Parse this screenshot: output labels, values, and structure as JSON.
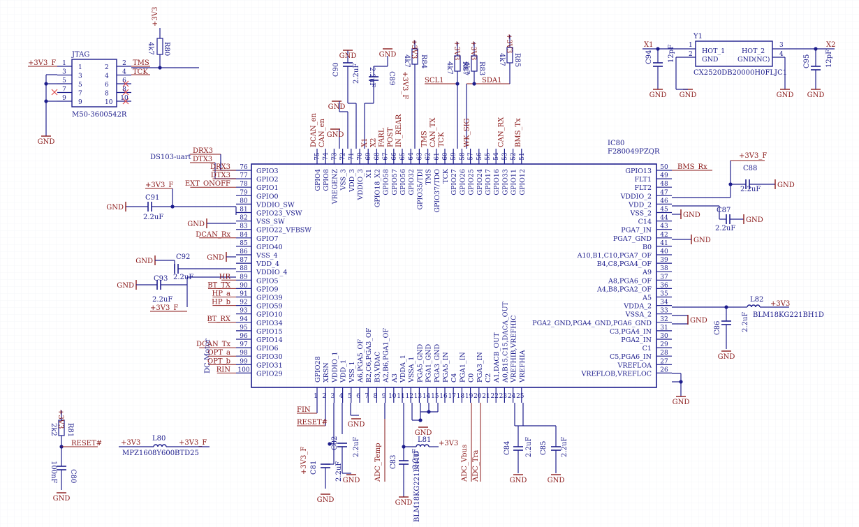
{
  "colors": {
    "wire": "#1d1d8c",
    "body": "#1d1d8c",
    "text": "#1d1d8c",
    "net": "#8b1a1a",
    "power": "#8b1a1a",
    "cross": "#e05050",
    "grid": "#eef0f4"
  },
  "mcu": {
    "designator": "IC80",
    "part": "F280049PZQR",
    "left_pins": [
      {
        "num": "76",
        "name": "GPIO3",
        "net": "DRX3"
      },
      {
        "num": "77",
        "name": "GPIO2",
        "net": "DTX3"
      },
      {
        "num": "78",
        "name": "GPIO1",
        "net": "EXT_ONOFF"
      },
      {
        "num": "79",
        "name": "GPIO0",
        "net": ""
      },
      {
        "num": "80",
        "name": "VDDIO_SW",
        "net": ""
      },
      {
        "num": "81",
        "name": "GPIO23_VSW",
        "net": ""
      },
      {
        "num": "82",
        "name": "VSS_SW",
        "net": ""
      },
      {
        "num": "83",
        "name": "GPIO22_VFBSW",
        "net": ""
      },
      {
        "num": "84",
        "name": "GPIO7",
        "net": "DCAN_Rx"
      },
      {
        "num": "85",
        "name": "GPIO40",
        "net": ""
      },
      {
        "num": "86",
        "name": "VSS_4",
        "net": ""
      },
      {
        "num": "87",
        "name": "VDD_4",
        "net": ""
      },
      {
        "num": "88",
        "name": "VDDIO_4",
        "net": ""
      },
      {
        "num": "89",
        "name": "GPIO5",
        "net": "HR"
      },
      {
        "num": "90",
        "name": "GPIO9",
        "net": "BT_TX"
      },
      {
        "num": "91",
        "name": "GPIO39",
        "net": "HP_a"
      },
      {
        "num": "92",
        "name": "GPIO59",
        "net": "HP_b"
      },
      {
        "num": "93",
        "name": "GPIO10",
        "net": ""
      },
      {
        "num": "94",
        "name": "GPIO34",
        "net": "BT_RX"
      },
      {
        "num": "95",
        "name": "GPIO15",
        "net": ""
      },
      {
        "num": "96",
        "name": "GPIO14",
        "net": ""
      },
      {
        "num": "97",
        "name": "GPIO6",
        "net": "DCAN_Tx"
      },
      {
        "num": "98",
        "name": "GPIO30",
        "net": "OPT_a"
      },
      {
        "num": "99",
        "name": "GPIO31",
        "net": "OPT_b"
      },
      {
        "num": "100",
        "name": "GPIO29",
        "net": "RIN"
      }
    ],
    "right_pins": [
      {
        "num": "50",
        "name": "GPIO13",
        "net": "BMS_Rx"
      },
      {
        "num": "49",
        "name": "FLT1",
        "net": ""
      },
      {
        "num": "48",
        "name": "FLT2",
        "net": ""
      },
      {
        "num": "47",
        "name": "VDDIO_2",
        "net": ""
      },
      {
        "num": "46",
        "name": "VDD_2",
        "net": ""
      },
      {
        "num": "45",
        "name": "VSS_2",
        "net": ""
      },
      {
        "num": "44",
        "name": "C14",
        "net": ""
      },
      {
        "num": "43",
        "name": "PGA7_IN",
        "net": ""
      },
      {
        "num": "42",
        "name": "PGA7_GND",
        "net": ""
      },
      {
        "num": "41",
        "name": "B0",
        "net": ""
      },
      {
        "num": "40",
        "name": "A10,B1,C10,PGA7_OF",
        "net": ""
      },
      {
        "num": "39",
        "name": "B4,C8,PGA4_OF",
        "net": ""
      },
      {
        "num": "38",
        "name": "A9",
        "net": ""
      },
      {
        "num": "37",
        "name": "A8,PGA6_OF",
        "net": ""
      },
      {
        "num": "36",
        "name": "A4,B8,PGA2_OF",
        "net": ""
      },
      {
        "num": "35",
        "name": "A5",
        "net": ""
      },
      {
        "num": "34",
        "name": "VDDA_2",
        "net": ""
      },
      {
        "num": "33",
        "name": "VSSA_2",
        "net": ""
      },
      {
        "num": "32",
        "name": "PGA2_GND,PGA4_GND,PGA6_GND",
        "net": ""
      },
      {
        "num": "31",
        "name": "C3,PGA4_IN",
        "net": ""
      },
      {
        "num": "30",
        "name": "PGA2_IN",
        "net": ""
      },
      {
        "num": "29",
        "name": "C1",
        "net": ""
      },
      {
        "num": "28",
        "name": "C5,PGA6_IN",
        "net": ""
      },
      {
        "num": "27",
        "name": "VREFLOA",
        "net": ""
      },
      {
        "num": "26",
        "name": "VREFLOB,VREFLOC",
        "net": ""
      }
    ],
    "top_pins": [
      {
        "num": "75",
        "name": "GPIO4",
        "net": "DCAN_en"
      },
      {
        "num": "74",
        "name": "GPIO8",
        "net": "CAN_en"
      },
      {
        "num": "73",
        "name": "VREGENZ",
        "net": ""
      },
      {
        "num": "72",
        "name": "VSS_3",
        "net": ""
      },
      {
        "num": "71",
        "name": "VDD_3",
        "net": ""
      },
      {
        "num": "70",
        "name": "VDDIO_3",
        "net": ""
      },
      {
        "num": "69",
        "name": "X1",
        "net": "X1"
      },
      {
        "num": "68",
        "name": "GPIO18_X2",
        "net": "X2"
      },
      {
        "num": "67",
        "name": "GPIO58",
        "net": "FARL"
      },
      {
        "num": "66",
        "name": "GPIO57",
        "net": "POST"
      },
      {
        "num": "65",
        "name": "GPIO56",
        "net": "IN_REAR"
      },
      {
        "num": "64",
        "name": "GPIO32",
        "net": ""
      },
      {
        "num": "63",
        "name": "GPIO35/TDI",
        "net": ""
      },
      {
        "num": "62",
        "name": "TMS",
        "net": "TMS"
      },
      {
        "num": "61",
        "name": "GPIO37/TDO",
        "net": "CAN_TX"
      },
      {
        "num": "60",
        "name": "TCK",
        "net": "TCK"
      },
      {
        "num": "59",
        "name": "GPIO27",
        "net": ""
      },
      {
        "num": "58",
        "name": "GPIO26",
        "net": ""
      },
      {
        "num": "57",
        "name": "GPIO25",
        "net": "WK_SIG"
      },
      {
        "num": "56",
        "name": "GPIO24",
        "net": ""
      },
      {
        "num": "55",
        "name": "GPIO17",
        "net": ""
      },
      {
        "num": "54",
        "name": "GPIO16",
        "net": ""
      },
      {
        "num": "53",
        "name": "GPIO33",
        "net": "CAN_RX"
      },
      {
        "num": "52",
        "name": "GPIO11",
        "net": ""
      },
      {
        "num": "51",
        "name": "GPIO12",
        "net": "BMS_Tx"
      }
    ],
    "bottom_pins": [
      {
        "num": "1",
        "name": "GPIO28"
      },
      {
        "num": "2",
        "name": "XRSN"
      },
      {
        "num": "3",
        "name": "VDDIO_1"
      },
      {
        "num": "4",
        "name": "VDD_1"
      },
      {
        "num": "5",
        "name": "VSS_1"
      },
      {
        "num": "6",
        "name": "A6,PGA5_OF"
      },
      {
        "num": "7",
        "name": "B2,C6,PGA3_OF"
      },
      {
        "num": "8",
        "name": "B3,VDAC"
      },
      {
        "num": "9",
        "name": "A2,B6,PGA1_OF"
      },
      {
        "num": "10",
        "name": "A3"
      },
      {
        "num": "11",
        "name": "VDDA_1"
      },
      {
        "num": "12",
        "name": "VSSA_1"
      },
      {
        "num": "13",
        "name": "PGA5_GND"
      },
      {
        "num": "14",
        "name": "PGA1_GND"
      },
      {
        "num": "15",
        "name": "PGA3_GND"
      },
      {
        "num": "16",
        "name": "PGA5_IN"
      },
      {
        "num": "17",
        "name": "C4"
      },
      {
        "num": "18",
        "name": "PGA1_IN"
      },
      {
        "num": "19",
        "name": "C0"
      },
      {
        "num": "20",
        "name": "PGA3_IN"
      },
      {
        "num": "21",
        "name": "C2"
      },
      {
        "num": "22",
        "name": "A1,DACB_OUT"
      },
      {
        "num": "23",
        "name": "A0,B15,C15,DACA_OUT"
      },
      {
        "num": "24",
        "name": "VREFHIB,VREFHIC"
      },
      {
        "num": "25",
        "name": "VREFHIA"
      }
    ]
  },
  "jtag": {
    "title": "JTAG",
    "part": "M50-3600542R",
    "left_pins": [
      "1",
      "3",
      "5",
      "7",
      "9"
    ],
    "right_pins": [
      "2",
      "4",
      "6",
      "8",
      "10"
    ],
    "left_outer": [
      "1",
      "3",
      "5",
      "7",
      "9"
    ],
    "right_outer": [
      "2",
      "4",
      "6",
      "8",
      "10"
    ],
    "net_power": "+3V3_F",
    "net_tms": "TMS",
    "net_tck": "TCK"
  },
  "crystal": {
    "designator": "Y1",
    "part": "CX2520DB20000H0FLJC1",
    "pin_labels": [
      "HOT_1",
      "GND",
      "HOT_2",
      "GND(NC)"
    ],
    "pin_nums": [
      "1",
      "2",
      "3",
      "4"
    ],
    "net_x1": "X1",
    "net_x2": "X2"
  },
  "labels": {
    "ds103": "DS103-uart",
    "dc_motor": "DC Motor",
    "gnd": "GND",
    "v33": "+3V3",
    "v33f": "+3V3_F",
    "fin": "FIN",
    "reset_n": "RESET#",
    "reset_n2": "RESET#",
    "scl1": "SCL1",
    "sda1": "SDA1",
    "adc_temp": "ADC_Temp",
    "adc_vbus": "ADC_Vbus",
    "adc_tra": "ADC_Tra"
  },
  "parts": {
    "R80": {
      "ref": "R80",
      "val": "4k7"
    },
    "R84": {
      "ref": "R84",
      "val": "4k7"
    },
    "R87": {
      "ref": "R87",
      "val": "4k7"
    },
    "R83": {
      "ref": "R83",
      "val": "4k7"
    },
    "R85": {
      "ref": "R85",
      "val": "4k7"
    },
    "R81": {
      "ref": "R81",
      "val": "2k2"
    },
    "C90": {
      "ref": "C90",
      "val": "2.2uF"
    },
    "C89": {
      "ref": "C89",
      "val": "2.2uF"
    },
    "C91": {
      "ref": "C91",
      "val": "2.2uF"
    },
    "C92": {
      "ref": "C92",
      "val": "2.2uF"
    },
    "C93": {
      "ref": "C93",
      "val": "2.2uF"
    },
    "C88": {
      "ref": "C88",
      "val": "2.2uF"
    },
    "C87": {
      "ref": "C87",
      "val": "2.2uF"
    },
    "C86": {
      "ref": "C86",
      "val": "2.2uF"
    },
    "C94": {
      "ref": "C94",
      "val": "12pF"
    },
    "C95": {
      "ref": "C95",
      "val": "12pF"
    },
    "C80": {
      "ref": "C80",
      "val": "100nF"
    },
    "C81": {
      "ref": "C81",
      "val": "2.2uF"
    },
    "C82": {
      "ref": "C82",
      "val": "2.2uF"
    },
    "C83": {
      "ref": "C83",
      "val": "2.2uF"
    },
    "C84": {
      "ref": "C84",
      "val": "2.2uF"
    },
    "C85": {
      "ref": "C85",
      "val": "2.2uF"
    },
    "L80": {
      "ref": "L80",
      "val": "MPZ1608Y600BTD25"
    },
    "L81": {
      "ref": "L81",
      "val": "BLM18KG221BH1D"
    },
    "L82": {
      "ref": "L82",
      "val": "BLM18KG221BH1D"
    }
  }
}
